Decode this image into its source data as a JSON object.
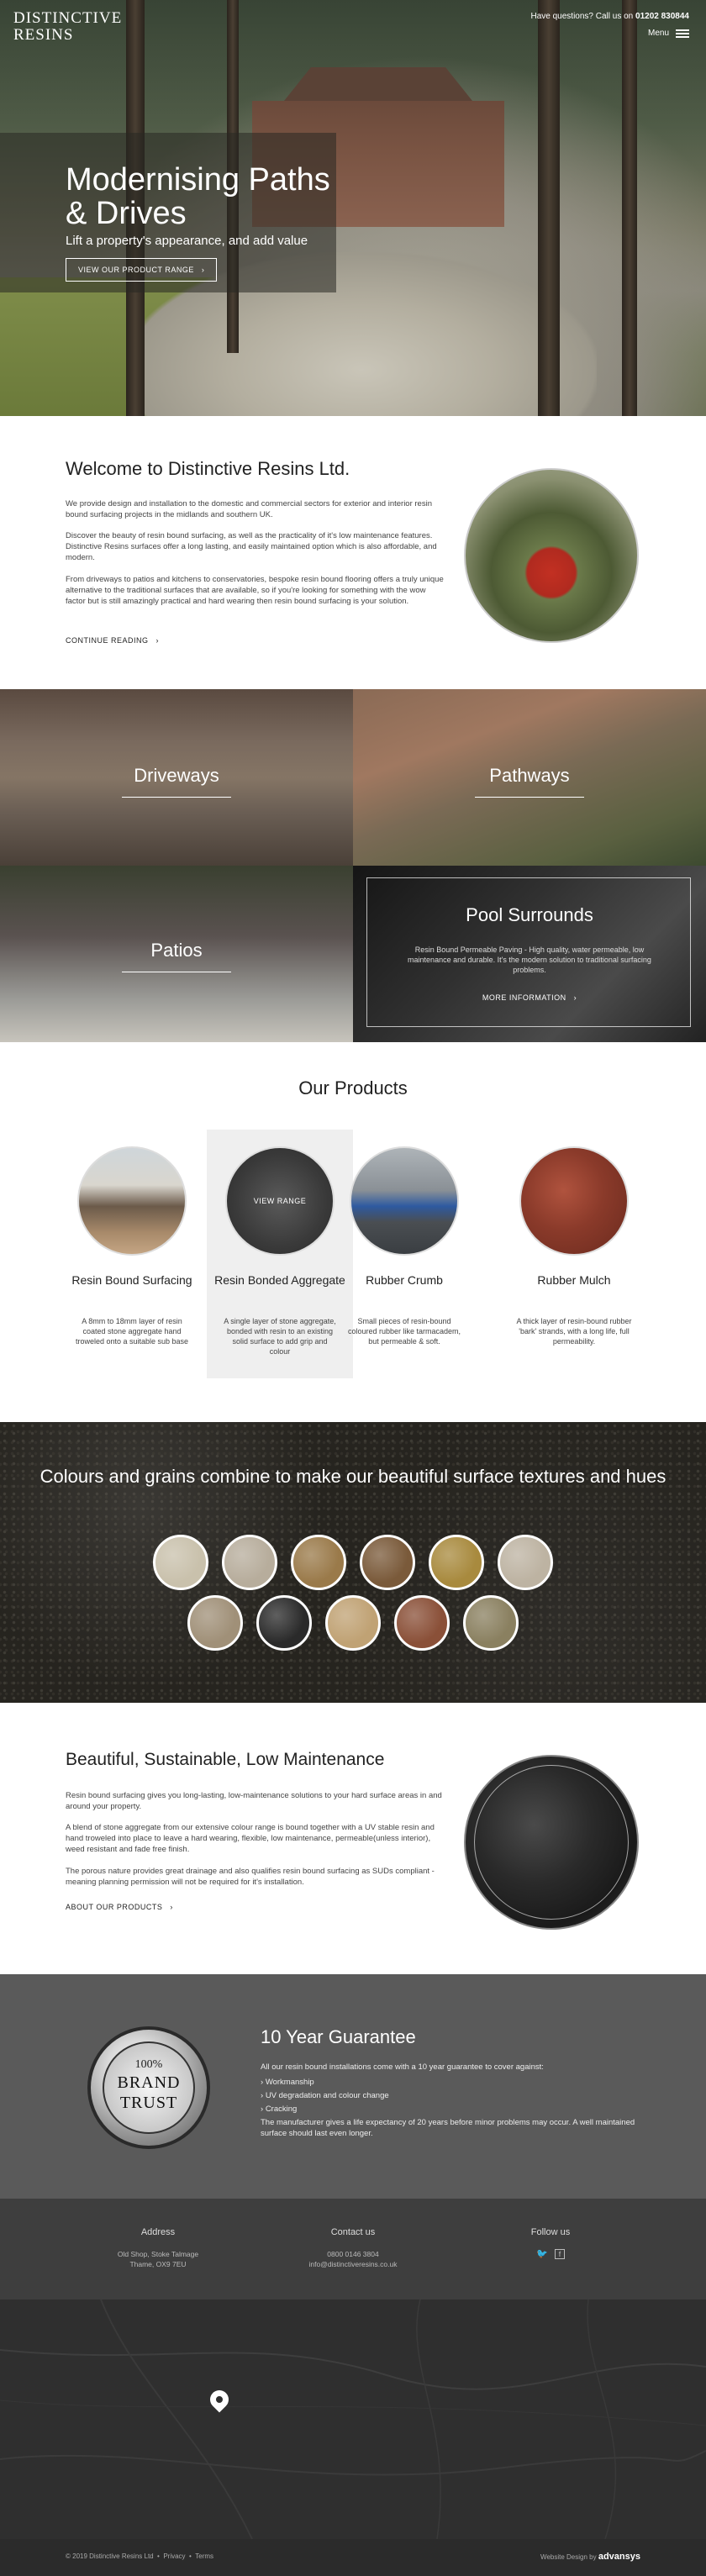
{
  "header": {
    "logo_line1": "DISTINCTIVE",
    "logo_line2": "RESINS",
    "phone_prefix": "Have questions? Call us on",
    "phone_number": "01202 830844",
    "menu_label": "Menu"
  },
  "hero": {
    "title": "Modernising Paths & Drives",
    "subtitle": "Lift a property's appearance, and add value",
    "button": "VIEW OUR PRODUCT RANGE"
  },
  "welcome": {
    "title": "Welcome to Distinctive Resins Ltd.",
    "p1": "We provide design and installation to the domestic and commercial sectors for exterior and interior resin bound surfacing projects in the midlands and southern UK.",
    "p2": "Discover the beauty of resin bound surfacing, as well as the practicality of it's low maintenance features. Distinctive Resins surfaces offer a long lasting, and easily maintained option which is also affordable, and modern.",
    "p3": "From driveways to patios and kitchens to conservatories, bespoke resin bound flooring offers a truly unique alternative to the traditional surfaces that are available, so if you're looking for something with the wow factor but is still amazingly practical and hard wearing then resin bound surfacing is your solution.",
    "link": "CONTINUE READING"
  },
  "tiles": {
    "driveways": "Driveways",
    "pathways": "Pathways",
    "patios": "Patios",
    "pool_title": "Pool Surrounds",
    "pool_text": "Resin Bound Permeable Paving - High quality, water permeable, low maintenance and durable. It's the modern solution to traditional surfacing problems.",
    "pool_button": "MORE INFORMATION"
  },
  "products": {
    "title": "Our Products",
    "view_range": "VIEW RANGE",
    "items": [
      {
        "title": "Resin Bound Surfacing",
        "desc": "A 8mm to 18mm layer of resin coated stone aggregate hand troweled onto a suitable sub base"
      },
      {
        "title": "Resin Bonded Aggregate",
        "desc": "A single layer of stone aggregate, bonded with resin to an existing solid surface to add grip and colour"
      },
      {
        "title": "Rubber Crumb",
        "desc": "Small pieces of resin-bound coloured rubber like tarmacadem, but permeable & soft."
      },
      {
        "title": "Rubber Mulch",
        "desc": "A thick layer of resin-bound rubber 'bark' strands, with a long life, full permeability."
      }
    ]
  },
  "colours": {
    "title": "Colours and grains combine to make our beautiful surface textures and hues",
    "swatches": [
      "#c9c1ac",
      "#b7ad9c",
      "#9a7a4a",
      "#7a5a3a",
      "#a88a3e",
      "#bdb3a2",
      "#a09078",
      "#2a2a2a",
      "#c0a274",
      "#8a5038",
      "#8a8060"
    ]
  },
  "beautiful": {
    "title": "Beautiful, Sustainable, Low Maintenance",
    "p1": "Resin bound surfacing gives you long-lasting, low-maintenance solutions to your hard surface areas in and around your property.",
    "p2": "A blend of stone aggregate from our extensive colour range is bound together with a UV stable resin and hand troweled into place to leave a hard wearing, flexible, low maintenance, permeable(unless interior), weed resistant and fade free finish.",
    "p3": "The porous nature provides great drainage and also qualifies resin bound surfacing as SUDs compliant - meaning planning permission will not be required for it's installation.",
    "link": "ABOUT OUR PRODUCTS"
  },
  "guarantee": {
    "badge_top": "100%",
    "badge_mid": "BRAND",
    "badge_bot": "TRUST",
    "title": "10 Year Guarantee",
    "intro": "All our resin bound installations come with a 10 year guarantee to cover against:",
    "items": [
      "Workmanship",
      "UV degradation and colour change",
      "Cracking"
    ],
    "outro": "The manufacturer gives a life expectancy of 20 years before minor problems may occur. A well maintained surface should last even longer."
  },
  "footer": {
    "address_title": "Address",
    "address_line1": "Old Shop, Stoke Talmage",
    "address_line2": "Thame, OX9 7EU",
    "contact_title": "Contact us",
    "contact_phone": "0800 0146 3804",
    "contact_email": "info@distinctiveresins.co.uk",
    "follow_title": "Follow us",
    "copyright": "© 2019 Distinctive Resins Ltd",
    "privacy": "Privacy",
    "terms": "Terms",
    "design_prefix": "Website Design by",
    "design_brand": "advansys"
  }
}
